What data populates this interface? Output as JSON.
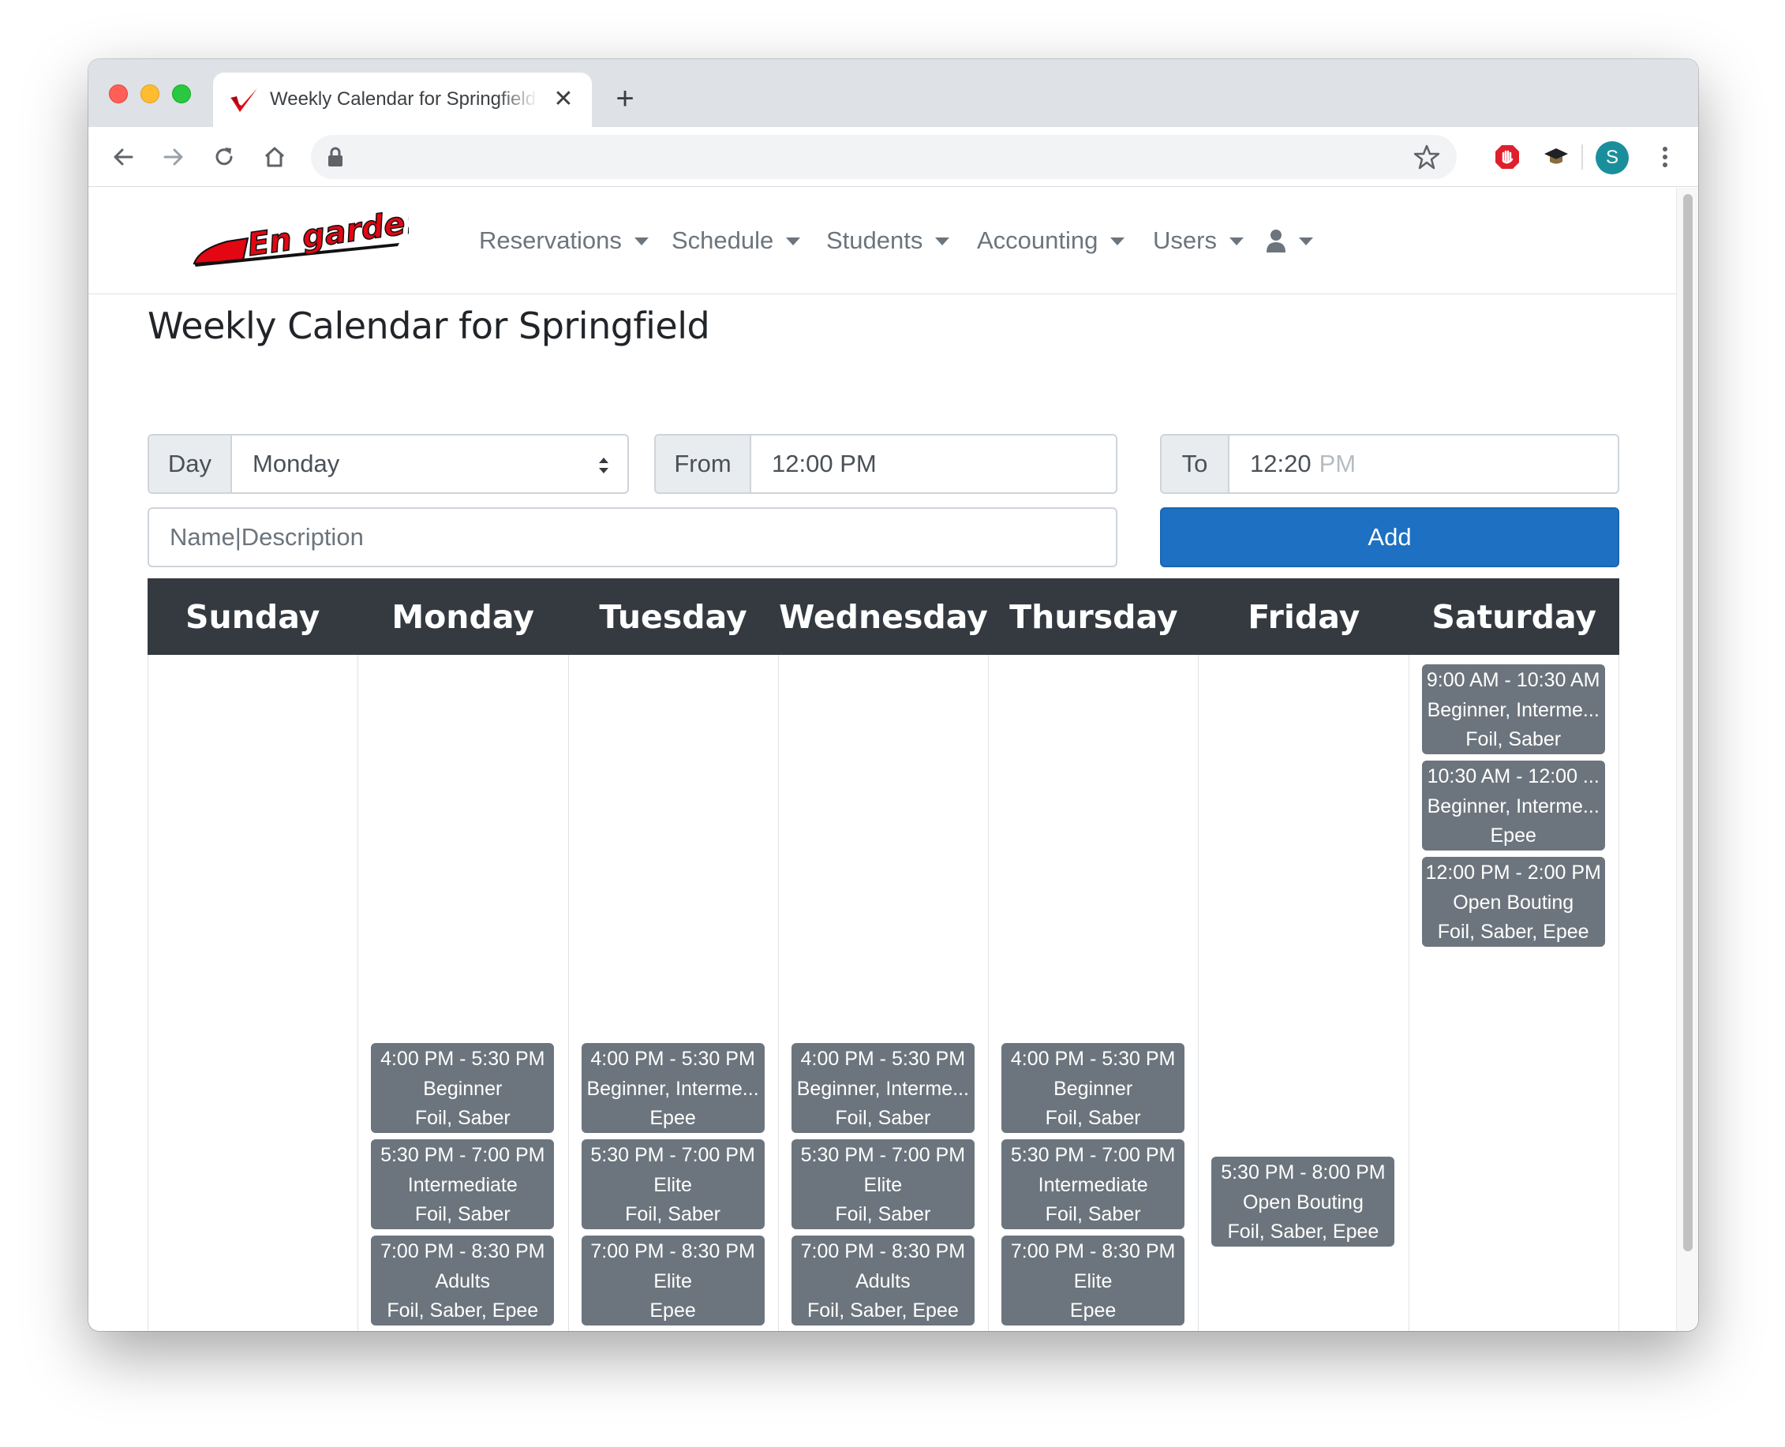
{
  "browser": {
    "tab_title": "Weekly Calendar for Springfield",
    "tab_close": "✕",
    "new_tab": "+",
    "address": "",
    "avatar_letter": "S"
  },
  "nav": {
    "logo_text": "En garde!",
    "items": [
      {
        "label": "Reservations"
      },
      {
        "label": "Schedule"
      },
      {
        "label": "Students"
      },
      {
        "label": "Accounting"
      },
      {
        "label": "Users"
      }
    ],
    "user_menu_icon": "user-icon"
  },
  "page_title": "Weekly Calendar for Springfield",
  "form": {
    "day_label": "Day",
    "day_value": "Monday",
    "from_label": "From",
    "from_value": "12:00 PM",
    "to_label": "To",
    "to_value": "12:20",
    "to_ampm": "PM",
    "name_placeholder": "Name|Description",
    "add_label": "Add"
  },
  "calendar": {
    "days": [
      "Sunday",
      "Monday",
      "Tuesday",
      "Wednesday",
      "Thursday",
      "Friday",
      "Saturday"
    ],
    "events": {
      "sunday": [],
      "monday": [
        {
          "time": "4:00 PM - 5:30 PM",
          "name": "Beginner",
          "weapons": "Foil, Saber"
        },
        {
          "time": "5:30 PM - 7:00 PM",
          "name": "Intermediate",
          "weapons": "Foil, Saber"
        },
        {
          "time": "7:00 PM - 8:30 PM",
          "name": "Adults",
          "weapons": "Foil, Saber, Epee"
        }
      ],
      "tuesday": [
        {
          "time": "4:00 PM - 5:30 PM",
          "name": "Beginner, Interme...",
          "weapons": "Epee"
        },
        {
          "time": "5:30 PM - 7:00 PM",
          "name": "Elite",
          "weapons": "Foil, Saber"
        },
        {
          "time": "7:00 PM - 8:30 PM",
          "name": "Elite",
          "weapons": "Epee"
        }
      ],
      "wednesday": [
        {
          "time": "4:00 PM - 5:30 PM",
          "name": "Beginner, Interme...",
          "weapons": "Foil, Saber"
        },
        {
          "time": "5:30 PM - 7:00 PM",
          "name": "Elite",
          "weapons": "Foil, Saber"
        },
        {
          "time": "7:00 PM - 8:30 PM",
          "name": "Adults",
          "weapons": "Foil, Saber, Epee"
        }
      ],
      "thursday": [
        {
          "time": "4:00 PM - 5:30 PM",
          "name": "Beginner",
          "weapons": "Foil, Saber"
        },
        {
          "time": "5:30 PM - 7:00 PM",
          "name": "Intermediate",
          "weapons": "Foil, Saber"
        },
        {
          "time": "7:00 PM - 8:30 PM",
          "name": "Elite",
          "weapons": "Epee"
        }
      ],
      "friday": [
        {
          "time": "5:30 PM - 8:00 PM",
          "name": "Open Bouting",
          "weapons": "Foil, Saber, Epee"
        }
      ],
      "saturday": [
        {
          "time": "9:00 AM - 10:30 AM",
          "name": "Beginner, Interme...",
          "weapons": "Foil, Saber"
        },
        {
          "time": "10:30 AM - 12:00 ...",
          "name": "Beginner, Interme...",
          "weapons": "Epee"
        },
        {
          "time": "12:00 PM - 2:00 PM",
          "name": "Open Bouting",
          "weapons": "Foil, Saber, Epee"
        }
      ]
    }
  },
  "colors": {
    "event_bg": "#6c757d",
    "header_bg": "#343a40",
    "primary": "#1e70c2",
    "brand_red": "#e30613"
  }
}
